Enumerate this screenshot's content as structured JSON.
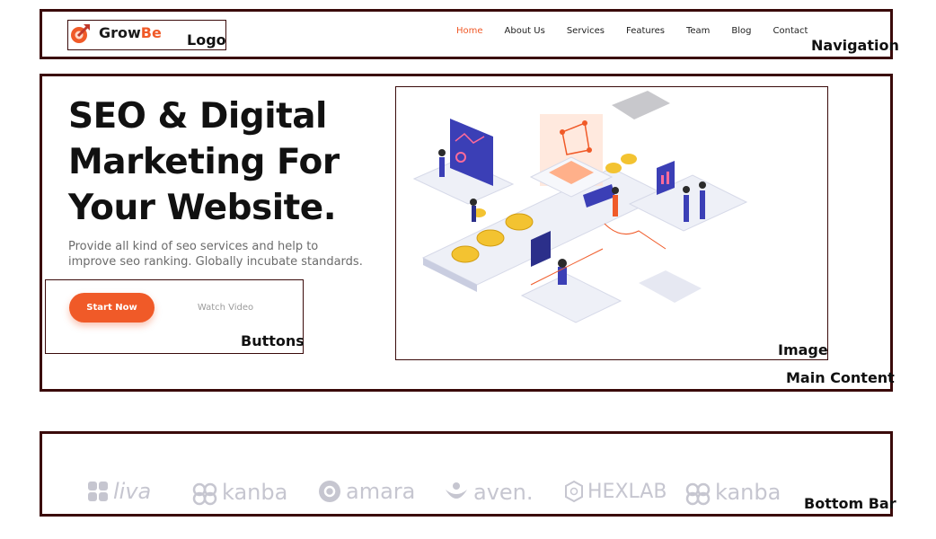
{
  "nav": {
    "logo": {
      "text_main": "Grow",
      "text_accent": "Be"
    },
    "links": [
      "Home",
      "About Us",
      "Services",
      "Features",
      "Team",
      "Blog",
      "Contact"
    ],
    "active_link": "Home"
  },
  "hero": {
    "title": "SEO & Digital Marketing For Your Website.",
    "subtitle": "Provide all kind of seo services and help to improve seo ranking. Globally incubate standards.",
    "start_button": "Start Now",
    "watch_button": "Watch Video"
  },
  "brands": [
    "liva",
    "kanba",
    "amara",
    "aven.",
    "HEXLAB",
    "kanba"
  ],
  "annotations": {
    "logo": "Logo",
    "navigation": "Navigation",
    "buttons": "Buttons",
    "image": "Image",
    "main_content": "Main Content",
    "bottom_bar": "Bottom Bar"
  },
  "colors": {
    "accent": "#f05a28",
    "frame": "#3a0a0a",
    "brand_gray": "#c6c6d0",
    "illustration_blue": "#3b3fb6"
  }
}
